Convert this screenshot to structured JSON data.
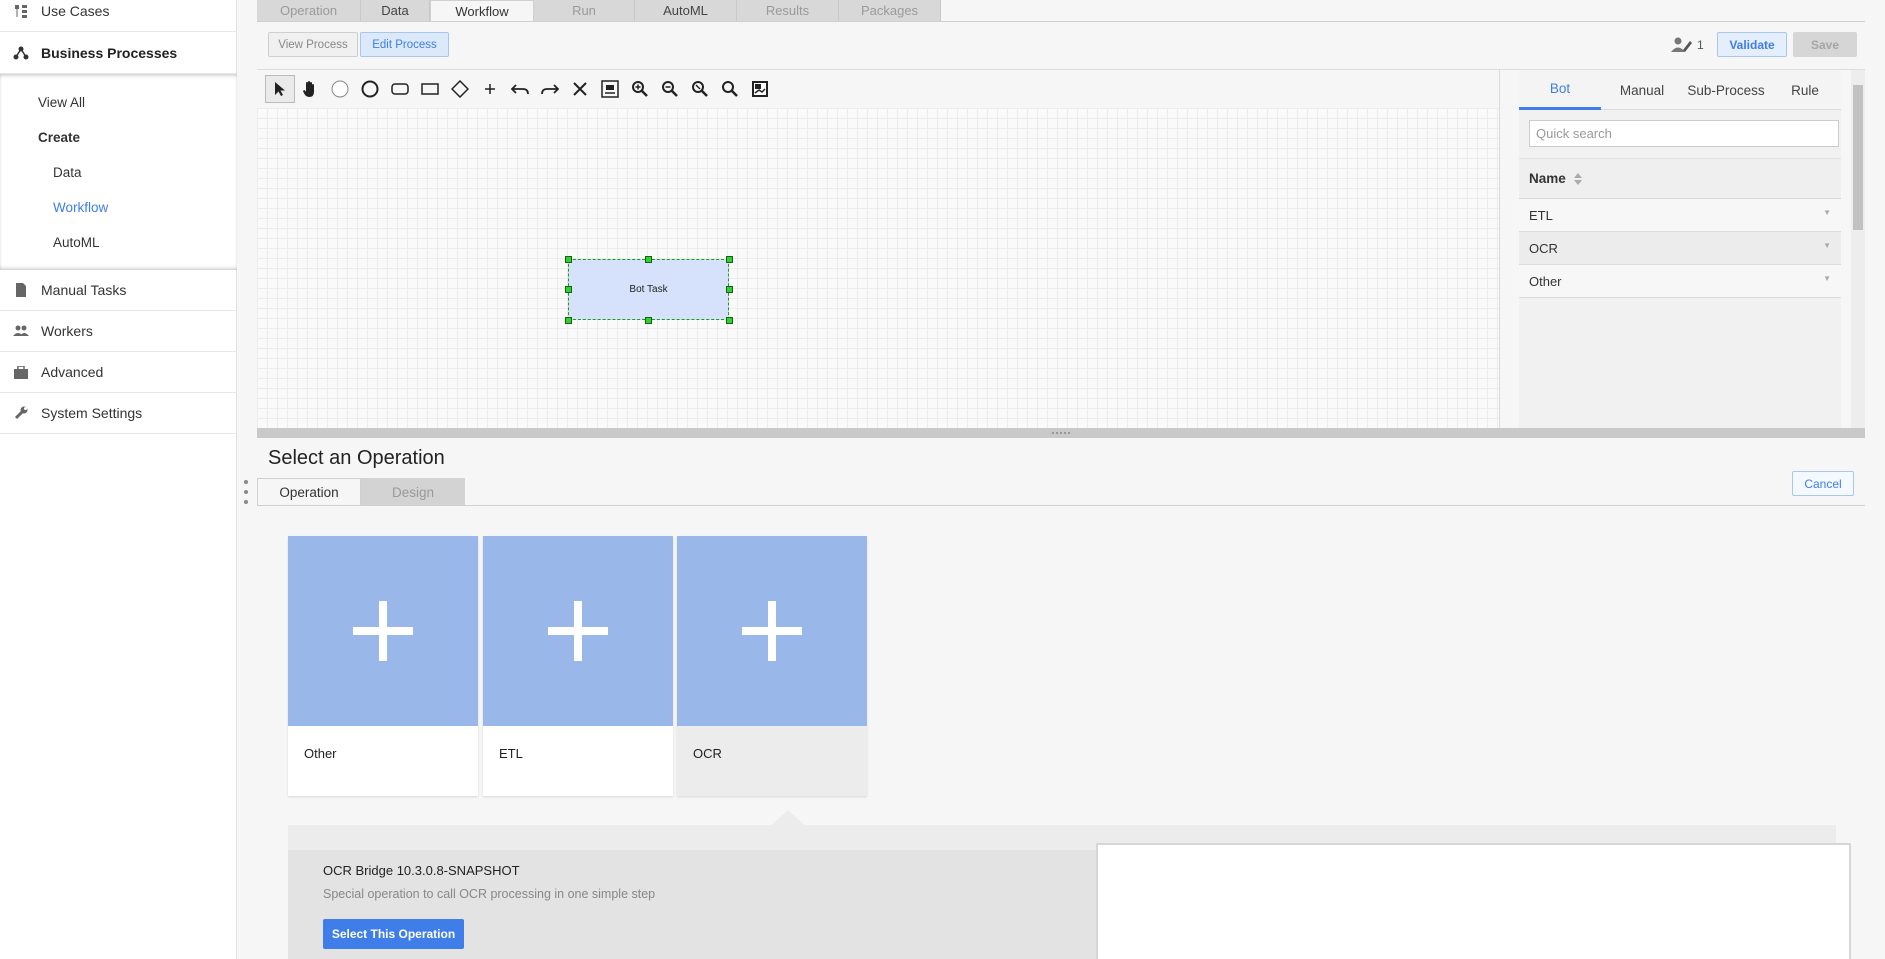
{
  "sidebar": {
    "use_cases": "Use Cases",
    "business_processes": "Business Processes",
    "view_all": "View All",
    "create": "Create",
    "data": "Data",
    "workflow": "Workflow",
    "automl": "AutoML",
    "manual_tasks": "Manual Tasks",
    "workers": "Workers",
    "advanced": "Advanced",
    "system_settings": "System Settings"
  },
  "top_tabs": [
    "Operation",
    "Data",
    "Workflow",
    "Run",
    "AutoML",
    "Results",
    "Packages"
  ],
  "process_toolbar": {
    "view_process": "View Process",
    "edit_process": "Edit Process",
    "user_count": "1",
    "validate": "Validate",
    "save": "Save"
  },
  "canvas": {
    "bot_task_label": "Bot Task",
    "tools": [
      "pointer-icon",
      "hand-icon",
      "start-event-icon",
      "end-event-icon",
      "rounded-task-icon",
      "task-icon",
      "gateway-icon",
      "plus-icon",
      "undo-icon",
      "redo-icon",
      "delete-icon",
      "fit-icon",
      "zoom-in-icon",
      "zoom-out-icon",
      "zoom-actual-icon",
      "zoom-icon",
      "outline-icon"
    ]
  },
  "right_panel": {
    "tabs": [
      "Bot",
      "Manual",
      "Sub-Process",
      "Rule"
    ],
    "search_placeholder": "Quick search",
    "column_header": "Name",
    "rows": [
      "ETL",
      "OCR",
      "Other"
    ]
  },
  "operation_picker": {
    "title": "Select an Operation",
    "tabs": [
      "Operation",
      "Design"
    ],
    "cancel": "Cancel",
    "cards": [
      "Other",
      "ETL",
      "OCR"
    ],
    "detail": {
      "name": "OCR Bridge 10.3.0.8-SNAPSHOT",
      "description": "Special operation to call OCR processing in one simple step",
      "button": "Select This Operation"
    }
  },
  "colors": {
    "accent": "#3f7ee8",
    "card_tile": "#9ab7ea",
    "task_fill": "#d6e2fb",
    "selection_handle": "#2ed12e"
  }
}
